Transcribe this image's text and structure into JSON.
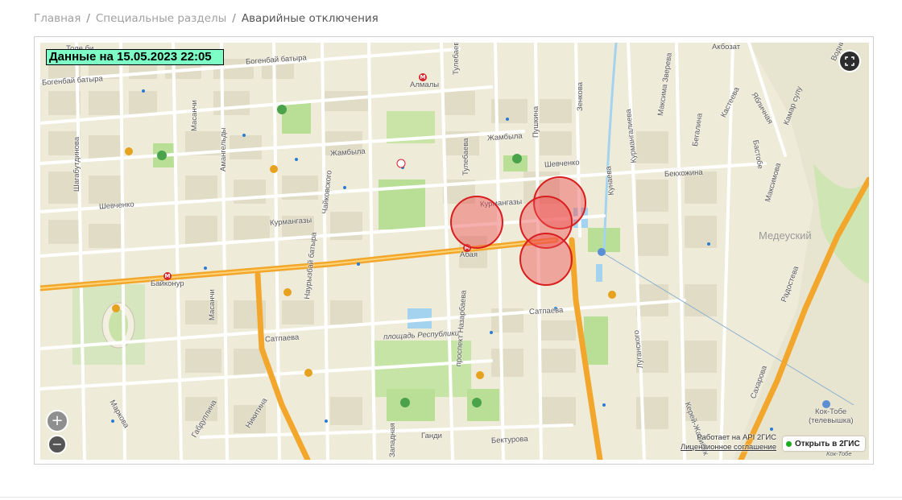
{
  "breadcrumb": {
    "items": [
      "Главная",
      "Специальные разделы"
    ],
    "current": "Аварийные отключения",
    "separator": "/"
  },
  "map": {
    "data_label": "Данные на 15.05.2023 22:05",
    "district": "Медеуский",
    "streets": {
      "tole_bi": "Толе би",
      "bogenbai_1": "Богенбай батыра",
      "bogenbai_2": "Богенбай батыра",
      "shevchenko_1": "Шевченко",
      "shevchenko_2": "Шевченко",
      "kurmangazy_1": "Курмангазы",
      "kurmangazy_2": "Курмангазы",
      "zhambyla_1": "Жамбыла",
      "zhambyla_2": "Жамбыла",
      "abaya": "Абая",
      "baikonur": "Байконур",
      "satpaeva_1": "Сатпаева",
      "satpaeva_2": "Сатпаева",
      "almaly": "Алмалы",
      "akbozat": "Акбозат",
      "bekkozhina": "Бекхожина",
      "ploshad": "площадь Республики",
      "gandi": "Ганди",
      "bekturova": "Бектурова",
      "kok_tobe": "Кок-Тобе",
      "kok_tobe_cable": "(телевышка)",
      "kok_tobe_small": "Кок-Тобе",
      "tulebaeva_1": "Тулебаева",
      "tulebaeva_2": "Тулебаева",
      "pushkina": "Пушкина",
      "zenkova": "Зенкова",
      "kunaeva": "Кунаева",
      "kurmangalieva": "Курмангалиева",
      "zhambyla_v": "Жамбыла",
      "masanchi_1": "Масанчи",
      "masanchi_2": "Масанчи",
      "amangeldy": "Амангельды",
      "shagabutdinova": "Шагабутдинова",
      "chaikovskogo": "Чайковского",
      "nauryzbai": "Наурызбай батыра",
      "nazarbaeva": "проспект Назарбаева",
      "lugansky": "Луганского",
      "sakharova": "Сахарова",
      "radosteva": "Радостева",
      "makatayeva": "Маркова",
      "gabdullina": "Габдуллина",
      "nikitina": "Никитина",
      "zatayevicha": "Западная",
      "kerey": "Керей-Жанибек",
      "zverev": "Максима Зверева",
      "kastaeva": "Кастеева",
      "beg": "Бегалина",
      "yavl": "Ябличная",
      "kamar": "Камар сулу",
      "bayzakova": "Бастобе",
      "maksimova": "Максимова",
      "vodnik": "Водник"
    },
    "metro_glyph": "М",
    "outages": [
      {
        "label": "outage-1"
      },
      {
        "label": "outage-2"
      },
      {
        "label": "outage-3"
      },
      {
        "label": "outage-4"
      }
    ]
  },
  "controls": {
    "zoom_in": "+",
    "zoom_out": "−",
    "fullscreen_icon": "fullscreen-icon"
  },
  "attribution": {
    "line1": "Работает на API 2ГИС",
    "line2": "Лицензионное соглашение",
    "open_button": "Открыть в 2ГИС"
  },
  "colors": {
    "major_road": "#f2a72c",
    "minor_road": "#ffffff",
    "park": "#b9df97",
    "water": "#a4d3f0",
    "outage_fill": "#ee5050",
    "outage_stroke": "#d81e1e",
    "data_label_bg": "#7effc6"
  }
}
